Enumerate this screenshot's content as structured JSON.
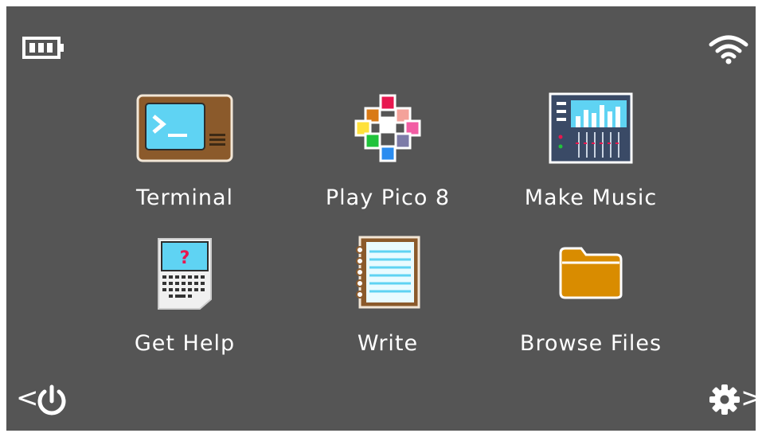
{
  "status": {
    "battery_icon": "battery-icon",
    "wifi_icon": "wifi-icon"
  },
  "apps": [
    {
      "label": "Terminal",
      "icon": "terminal-icon"
    },
    {
      "label": "Play Pico 8",
      "icon": "pico8-icon"
    },
    {
      "label": "Make Music",
      "icon": "music-mixer-icon"
    },
    {
      "label": "Get Help",
      "icon": "help-device-icon"
    },
    {
      "label": "Write",
      "icon": "notebook-icon"
    },
    {
      "label": "Browse Files",
      "icon": "folder-icon"
    }
  ],
  "nav": {
    "prev_arrow": "<",
    "next_arrow": ">",
    "power_icon": "power-icon",
    "settings_icon": "gear-icon"
  },
  "colors": {
    "background": "#555555",
    "text": "#ffffff",
    "folder": "#d98c00",
    "terminal_screen": "#5fd3f3"
  }
}
